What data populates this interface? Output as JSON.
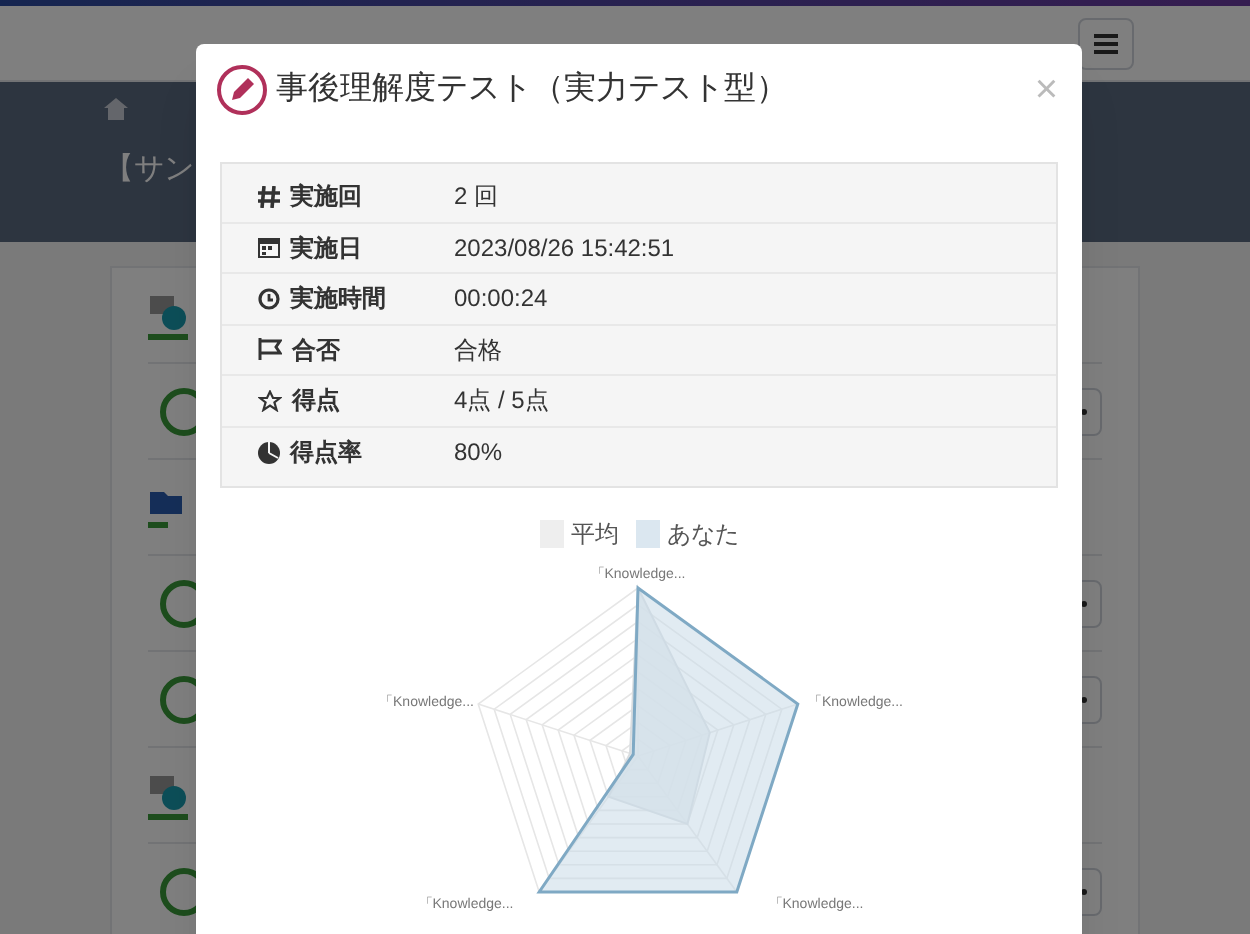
{
  "page": {
    "title": "【サン"
  },
  "background_items": [
    {
      "kind": "section"
    },
    {
      "kind": "row"
    },
    {
      "kind": "folder"
    },
    {
      "kind": "row"
    },
    {
      "kind": "row"
    },
    {
      "kind": "section"
    },
    {
      "kind": "row"
    }
  ],
  "modal": {
    "title": "事後理解度テスト（実力テスト型）",
    "close": "×",
    "details": [
      {
        "kind": "number",
        "label": "実施回",
        "value": "2 回"
      },
      {
        "kind": "calendar",
        "label": "実施日",
        "value": "2023/08/26 15:42:51"
      },
      {
        "kind": "clock",
        "label": "実施時間",
        "value": "00:00:24"
      },
      {
        "kind": "flag",
        "label": "合否",
        "value": "合格"
      },
      {
        "kind": "star",
        "label": "得点",
        "value": "4点 / 5点"
      },
      {
        "kind": "pie",
        "label": "得点率",
        "value": "80%"
      }
    ],
    "radar": {
      "legend": [
        {
          "label": "平均",
          "color": "#eeeeee"
        },
        {
          "label": "あなた",
          "color": "#dbe7f0"
        }
      ],
      "axis_labels": [
        "「Knowledge...",
        "「Knowledge...",
        "「Knowledge...",
        "「Knowledge...",
        "「Knowledge..."
      ]
    }
  }
}
